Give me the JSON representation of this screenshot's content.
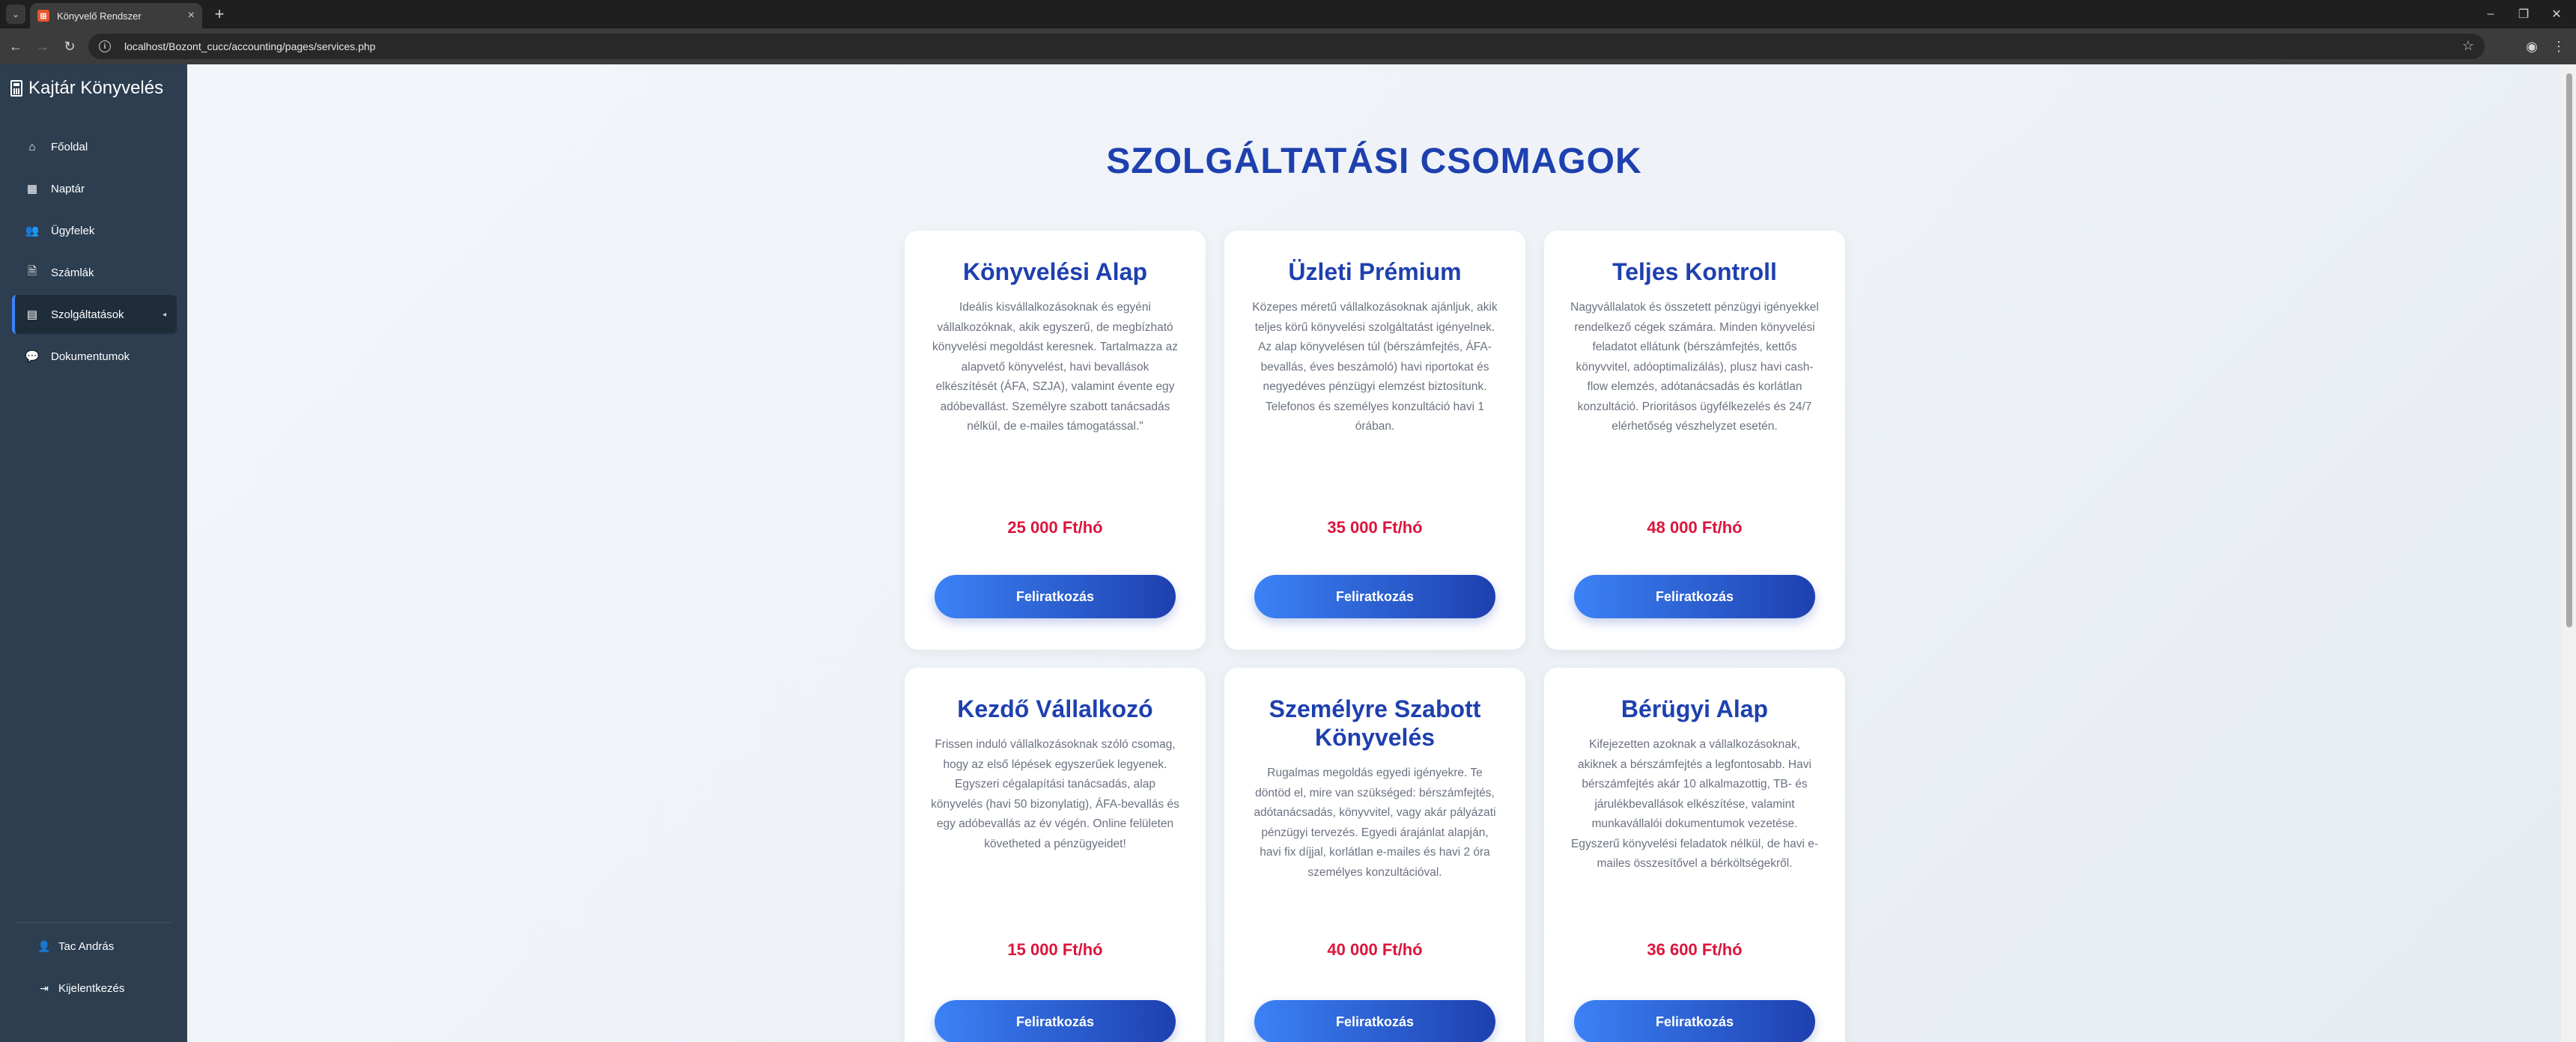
{
  "browser": {
    "tab_title": "Könyvelő Rendszer",
    "tab_favicon": "⊞",
    "url": "localhost/Bozont_cucc/accounting/pages/services.php"
  },
  "sidebar": {
    "brand": "Kajtár Könyvelés",
    "items": [
      {
        "label": "Főoldal",
        "icon": "home-icon",
        "glyph": "⌂"
      },
      {
        "label": "Naptár",
        "icon": "calendar-icon",
        "glyph": "▦"
      },
      {
        "label": "Ügyfelek",
        "icon": "users-icon",
        "glyph": "👥"
      },
      {
        "label": "Számlák",
        "icon": "invoice-icon",
        "glyph": "🗎"
      },
      {
        "label": "Szolgáltatások",
        "icon": "calculator-icon",
        "glyph": "▤",
        "active": true
      },
      {
        "label": "Dokumentumok",
        "icon": "comments-icon",
        "glyph": "💬"
      }
    ],
    "user": "Tac András",
    "logout": "Kijelentkezés"
  },
  "main": {
    "title": "SZOLGÁLTATÁSI CSOMAGOK",
    "cards": [
      {
        "title": "Könyvelési Alap",
        "description": "Ideális kisvállalkozásoknak és egyéni vállalkozóknak, akik egyszerű, de megbízható könyvelési megoldást keresnek. Tartalmazza az alapvető könyvelést, havi bevallások elkészítését (ÁFA, SZJA), valamint évente egy adóbevallást. Személyre szabott tanácsadás nélkül, de e-mailes támogatással.\"",
        "price": "25 000 Ft/hó",
        "button": "Feliratkozás"
      },
      {
        "title": "Üzleti Prémium",
        "description": "Közepes méretű vállalkozásoknak ajánljuk, akik teljes körű könyvelési szolgáltatást igényelnek. Az alap könyvelésen túl (bérszámfejtés, ÁFA-bevallás, éves beszámoló) havi riportokat és negyedéves pénzügyi elemzést biztosítunk. Telefonos és személyes konzultáció havi 1 órában.",
        "price": "35 000 Ft/hó",
        "button": "Feliratkozás"
      },
      {
        "title": "Teljes Kontroll",
        "description": "Nagyvállalatok és összetett pénzügyi igényekkel rendelkező cégek számára. Minden könyvelési feladatot ellátunk (bérszámfejtés, kettős könyvvitel, adóoptimalizálás), plusz havi cash-flow elemzés, adótanácsadás és korlátlan konzultáció. Prioritásos ügyfélkezelés és 24/7 elérhetőség vészhelyzet esetén.",
        "price": "48 000 Ft/hó",
        "button": "Feliratkozás"
      },
      {
        "title": "Kezdő Vállalkozó",
        "description": "Frissen induló vállalkozásoknak szóló csomag, hogy az első lépések egyszerűek legyenek. Egyszeri cégalapítási tanácsadás, alap könyvelés (havi 50 bizonylatig), ÁFA-bevallás és egy adóbevallás az év végén. Online felületen követheted a pénzügyeidet!",
        "price": "15 000 Ft/hó",
        "button": "Feliratkozás"
      },
      {
        "title": "Személyre Szabott Könyvelés",
        "description": "Rugalmas megoldás egyedi igényekre. Te döntöd el, mire van szükséged: bérszámfejtés, adótanácsadás, könyvvitel, vagy akár pályázati pénzügyi tervezés. Egyedi árajánlat alapján, havi fix díjjal, korlátlan e-mailes és havi 2 óra személyes konzultációval.",
        "price": "40 000 Ft/hó",
        "button": "Feliratkozás"
      },
      {
        "title": "Bérügyi Alap",
        "description": "Kifejezetten azoknak a vállalkozásoknak, akiknek a bérszámfejtés a legfontosabb. Havi bérszámfejtés akár 10 alkalmazottig, TB- és járulékbevallások elkészítése, valamint munkavállalói dokumentumok vezetése. Egyszerű könyvelési feladatok nélkül, de havi e-mailes összesítővel a bérköltségekről.",
        "price": "36 600 Ft/hó",
        "button": "Feliratkozás"
      }
    ]
  },
  "colors": {
    "sidebar_bg": "#2c3e50",
    "title": "#1e40af",
    "price": "#dc143c",
    "button_start": "#3b82f6",
    "button_end": "#1e40af"
  }
}
